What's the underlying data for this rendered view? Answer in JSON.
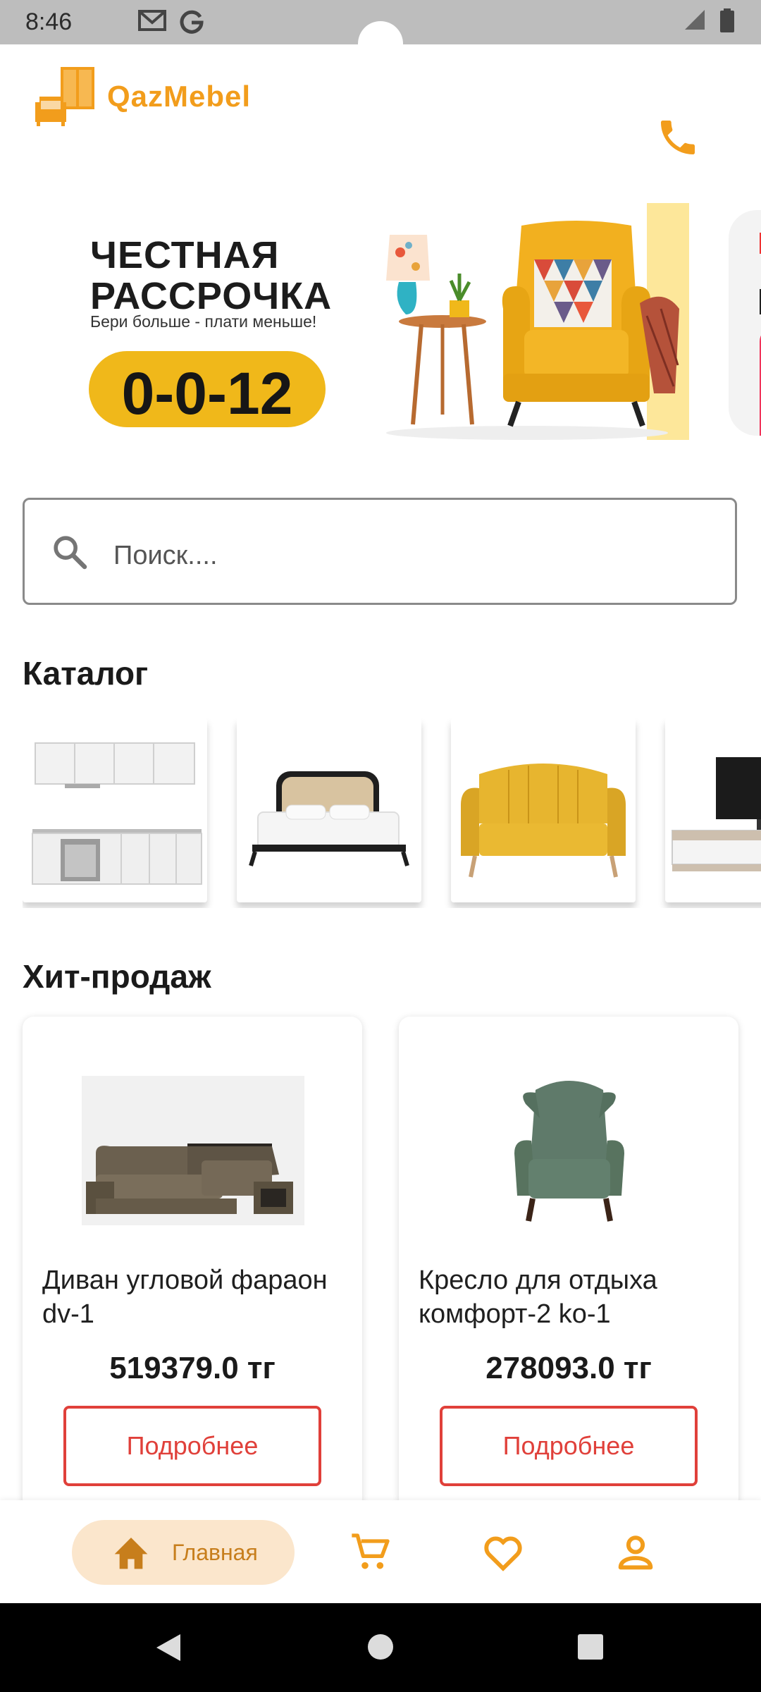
{
  "status_bar": {
    "time": "8:46"
  },
  "header": {
    "brand": "QazMebel",
    "accent": "#f29d1c"
  },
  "banner": {
    "title_line1": "ЧЕСТНАЯ",
    "title_line2": "РАССРОЧКА",
    "subtitle": "Бери больше - плати меньше!",
    "promo": "0-0-12"
  },
  "search": {
    "placeholder": "Поиск...."
  },
  "catalog": {
    "title": "Каталог"
  },
  "bestsellers": {
    "title": "Хит-продаж",
    "products": [
      {
        "name": "Диван угловой фараон dv-1",
        "price": "519379.0 тг",
        "button": "Подробнее"
      },
      {
        "name": "Кресло для отдыха комфорт-2 ko-1",
        "price": "278093.0 тг",
        "button": "Подробнее"
      }
    ]
  },
  "bottom_nav": {
    "home_label": "Главная"
  },
  "colors": {
    "button_border": "#e0403a",
    "promo_pill": "#f0b81a",
    "nav_active_bg": "#fbe6cc"
  }
}
